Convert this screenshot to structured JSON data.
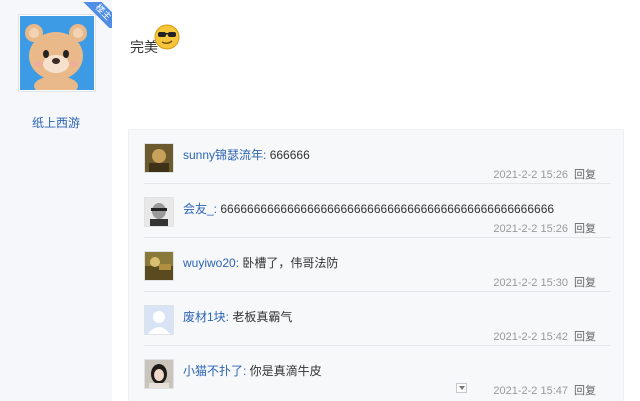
{
  "post": {
    "author": {
      "name": "纸上西游",
      "badge": "楼主"
    },
    "text": "完美",
    "emoji_icon": "sunglasses-emoji-icon"
  },
  "replies": [
    {
      "name": "sunny锦瑟流年:",
      "text": " 666666",
      "time": "2021-2-2 15:26",
      "reply": "回复"
    },
    {
      "name": "会友_:",
      "text": " 66666666666666666666666666666666666666666666666666",
      "time": "2021-2-2 15:26",
      "reply": "回复"
    },
    {
      "name": "wuyiwo20:",
      "text": " 卧槽了，伟哥法防",
      "time": "2021-2-2 15:30",
      "reply": "回复"
    },
    {
      "name": "废材1块:",
      "text": " 老板真霸气",
      "time": "2021-2-2 15:42",
      "reply": "回复"
    },
    {
      "name": "小猫不扑了:",
      "text": " 你是真滴牛皮",
      "time": "2021-2-2 15:47",
      "reply": "回复"
    }
  ],
  "colors": {
    "link": "#2d64b3",
    "badge": "#4f8de6",
    "reply_bg": "#f7f8fa"
  }
}
